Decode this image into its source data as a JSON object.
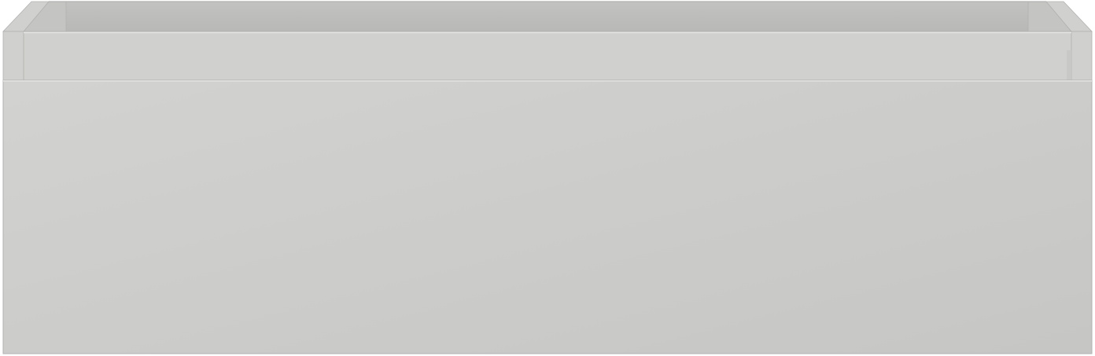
{
  "object": {
    "kind": "open drawer box",
    "colors": {
      "front": "#cbcbc9",
      "front_light": "#d2d2d0",
      "front_dark": "#c6c6c4",
      "inner_back": "#b8b8b6",
      "inner_back_top": "#c2c2c0",
      "side_walls": "#c4c4c2",
      "top_strip": "#d0d0ce",
      "edge_highlight": "#e4e4e2",
      "outline": "#b2b2b0"
    }
  }
}
